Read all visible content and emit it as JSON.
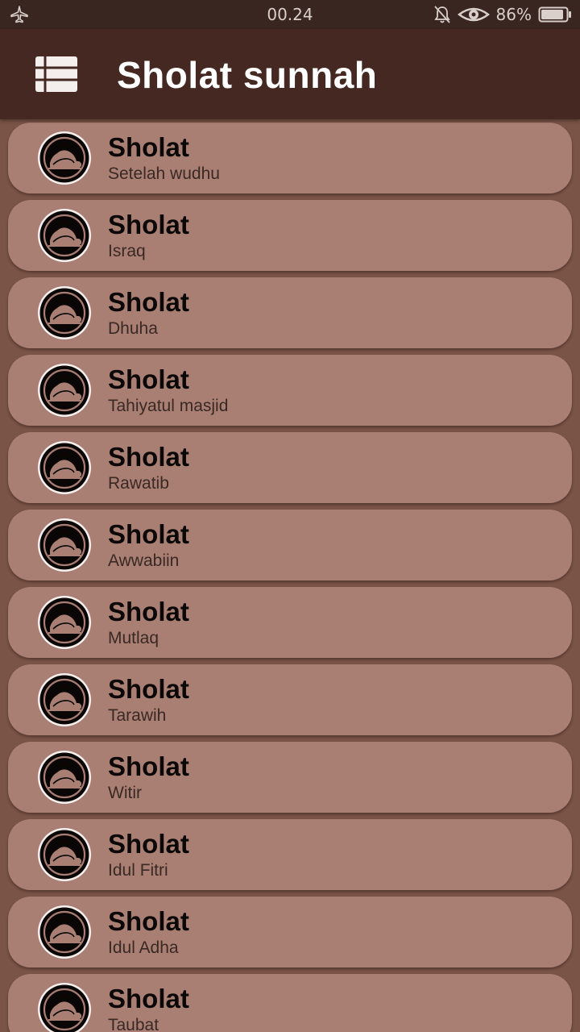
{
  "status_bar": {
    "time": "00.24",
    "battery_percent": "86%",
    "icons": [
      "airplane-mode-icon",
      "bell-off-icon",
      "eye-icon",
      "battery-icon"
    ]
  },
  "app_bar": {
    "title": "Sholat sunnah",
    "menu_icon": "list-menu-icon"
  },
  "colors": {
    "status_bar_bg": "#3a2620",
    "app_bar_bg": "#442821",
    "page_bg": "#7a5447",
    "card_bg": "#a97f74"
  },
  "items": [
    {
      "title": "Sholat",
      "subtitle": "Setelah wudhu",
      "icon": "prayer-prostration-icon"
    },
    {
      "title": "Sholat",
      "subtitle": "Israq",
      "icon": "prayer-prostration-icon"
    },
    {
      "title": "Sholat",
      "subtitle": "Dhuha",
      "icon": "prayer-prostration-icon"
    },
    {
      "title": "Sholat",
      "subtitle": "Tahiyatul masjid",
      "icon": "prayer-prostration-icon"
    },
    {
      "title": "Sholat",
      "subtitle": "Rawatib",
      "icon": "prayer-prostration-icon"
    },
    {
      "title": "Sholat",
      "subtitle": "Awwabiin",
      "icon": "prayer-prostration-icon"
    },
    {
      "title": "Sholat",
      "subtitle": "Mutlaq",
      "icon": "prayer-prostration-icon"
    },
    {
      "title": "Sholat",
      "subtitle": "Tarawih",
      "icon": "prayer-prostration-icon"
    },
    {
      "title": "Sholat",
      "subtitle": "Witir",
      "icon": "prayer-prostration-icon"
    },
    {
      "title": "Sholat",
      "subtitle": "Idul Fitri",
      "icon": "prayer-prostration-icon"
    },
    {
      "title": "Sholat",
      "subtitle": "Idul Adha",
      "icon": "prayer-prostration-icon"
    },
    {
      "title": "Sholat",
      "subtitle": "Taubat",
      "icon": "prayer-prostration-icon"
    }
  ]
}
